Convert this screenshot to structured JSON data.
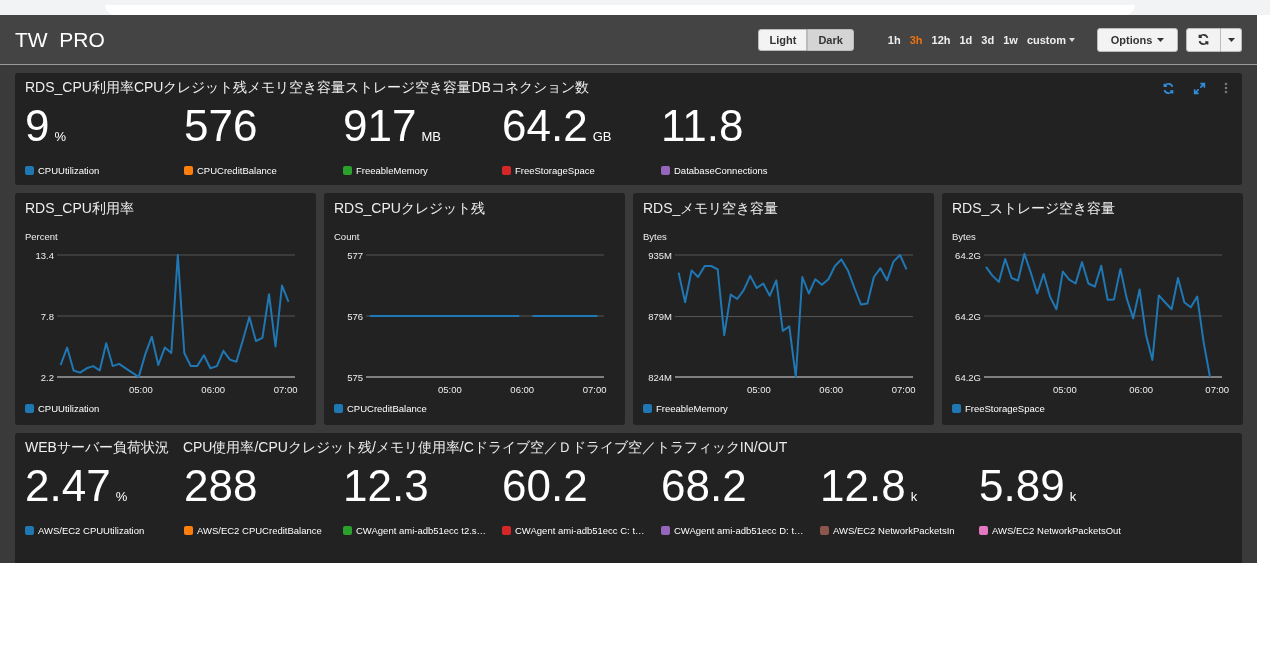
{
  "header": {
    "title": "TW  PRO",
    "theme_buttons": [
      {
        "label": "Light",
        "selected": false
      },
      {
        "label": "Dark",
        "selected": true
      }
    ],
    "time_ranges": [
      {
        "label": "1h",
        "selected": false,
        "kind": "preset"
      },
      {
        "label": "3h",
        "selected": true,
        "kind": "preset"
      },
      {
        "label": "12h",
        "selected": false,
        "kind": "preset"
      },
      {
        "label": "1d",
        "selected": false,
        "kind": "preset"
      },
      {
        "label": "3d",
        "selected": false,
        "kind": "preset"
      },
      {
        "label": "1w",
        "selected": false,
        "kind": "preset"
      },
      {
        "label": "custom",
        "selected": false,
        "kind": "dropdown"
      }
    ],
    "options_button": "Options"
  },
  "rds_summary": {
    "title": "RDS_CPU利用率CPUクレジット残メモリ空き容量ストレージ空き容量DBコネクション数",
    "metrics": [
      {
        "value": "9",
        "unit": "%",
        "label": "CPUUtilization",
        "color": "#1f77b4"
      },
      {
        "value": "576",
        "label": "CPUCreditBalance",
        "color": "#ff7f0e"
      },
      {
        "value": "917",
        "unit": "MB",
        "label": "FreeableMemory",
        "color": "#2ca02c"
      },
      {
        "value": "64.2",
        "unit": "GB",
        "label": "FreeStorageSpace",
        "color": "#d62728"
      },
      {
        "value": "11.8",
        "label": "DatabaseConnections",
        "color": "#9467bd"
      }
    ]
  },
  "charts": [
    {
      "kind": "line",
      "title": "RDS_CPU利用率",
      "chart_data": {
        "type": "line",
        "ylabel": "Percent",
        "x": [
          3.89,
          3.98,
          4.07,
          4.16,
          4.25,
          4.34,
          4.43,
          4.52,
          4.61,
          4.7,
          4.79,
          4.88,
          4.97,
          5.06,
          5.15,
          5.24,
          5.33,
          5.42,
          5.51,
          5.6,
          5.69,
          5.78,
          5.87,
          5.96,
          6.05,
          6.14,
          6.23,
          6.32,
          6.41,
          6.5,
          6.59,
          6.68,
          6.77,
          6.86,
          6.95,
          7.04
        ],
        "xlim": [
          3.84,
          7.13
        ],
        "xticks": [
          {
            "value": 5,
            "label": "05:00"
          },
          {
            "value": 6,
            "label": "06:00"
          },
          {
            "value": 7,
            "label": "07:00"
          }
        ],
        "ylim": [
          2.2,
          13.4
        ],
        "yticks": [
          2.2,
          7.8,
          13.4
        ],
        "series": [
          {
            "name": "CPUUtilization",
            "color": "#1f77b4",
            "values": [
              3.3,
              4.9,
              2.8,
              2.6,
              3.0,
              3.2,
              2.8,
              5.3,
              3.2,
              3.4,
              3.0,
              2.6,
              2.2,
              4.3,
              5.9,
              3.3,
              4.9,
              4.4,
              13.4,
              4.4,
              3.2,
              3.2,
              4.2,
              3.0,
              3.2,
              4.6,
              3.8,
              3.6,
              5.6,
              7.7,
              5.5,
              5.8,
              9.8,
              5.0,
              10.6,
              9.1
            ]
          }
        ]
      }
    },
    {
      "kind": "line",
      "title": "RDS_CPUクレジット残",
      "chart_data": {
        "type": "line",
        "ylabel": "Count",
        "x": [
          3.89,
          3.98,
          4.07,
          4.16,
          4.25,
          4.34,
          4.43,
          4.52,
          4.61,
          4.7,
          4.79,
          4.88,
          4.97,
          5.06,
          5.15,
          5.24,
          5.33,
          5.42,
          5.51,
          5.6,
          5.69,
          5.78,
          5.87,
          5.96,
          6.05,
          6.14,
          6.23,
          6.32,
          6.41,
          6.5,
          6.59,
          6.68,
          6.77,
          6.86,
          6.95,
          7.04
        ],
        "xlim": [
          3.84,
          7.13
        ],
        "xticks": [
          {
            "value": 5,
            "label": "05:00"
          },
          {
            "value": 6,
            "label": "06:00"
          },
          {
            "value": 7,
            "label": "07:00"
          }
        ],
        "ylim": [
          575,
          577
        ],
        "yticks": [
          575,
          576,
          577
        ],
        "series": [
          {
            "name": "CPUCreditBalance",
            "color": "#1f77b4",
            "values": [
              576,
              576,
              576,
              576,
              576,
              576,
              576,
              576,
              576,
              576,
              576,
              576,
              576,
              576,
              576,
              576,
              576,
              576,
              576,
              576,
              576,
              576,
              576,
              576,
              null,
              576,
              576,
              576,
              576,
              576,
              576,
              576,
              576,
              576,
              576,
              576
            ]
          }
        ]
      }
    },
    {
      "kind": "line",
      "title": "RDS_メモリ空き容量",
      "chart_data": {
        "type": "line",
        "ylabel": "Bytes",
        "x": [
          3.89,
          3.98,
          4.07,
          4.16,
          4.25,
          4.34,
          4.43,
          4.52,
          4.61,
          4.7,
          4.79,
          4.88,
          4.97,
          5.06,
          5.15,
          5.24,
          5.33,
          5.42,
          5.51,
          5.6,
          5.69,
          5.78,
          5.87,
          5.96,
          6.05,
          6.14,
          6.23,
          6.32,
          6.41,
          6.5,
          6.59,
          6.68,
          6.77,
          6.86,
          6.95,
          7.04
        ],
        "xlim": [
          3.84,
          7.13
        ],
        "xticks": [
          {
            "value": 5,
            "label": "05:00"
          },
          {
            "value": 6,
            "label": "06:00"
          },
          {
            "value": 7,
            "label": "07:00"
          }
        ],
        "ylim": [
          824,
          935
        ],
        "yticks": [
          {
            "value": 824,
            "label": "824M"
          },
          {
            "value": 879,
            "label": "879M"
          },
          {
            "value": 935,
            "label": "935M"
          }
        ],
        "series": [
          {
            "name": "FreeableMemory",
            "color": "#1f77b4",
            "values": [
              919,
              892,
              921,
              915,
              925,
              925,
              922,
              862,
              899,
              895,
              903,
              916,
              905,
              909,
              898,
              912,
              866,
              870,
              824,
              915,
              900,
              913,
              908,
              913,
              925,
              931,
              921,
              905,
              890,
              891,
              915,
              923,
              912,
              929,
              935,
              922
            ]
          }
        ]
      }
    },
    {
      "kind": "sparkline",
      "title": "RDS_ストレージ空き容量",
      "ylabel": "Bytes",
      "y_tick_labels": [
        "64.2G",
        "64.2G",
        "64.2G"
      ],
      "x_tick_labels": [
        "05:00",
        "06:00",
        "07:00"
      ],
      "legend": {
        "name": "FreeStorageSpace",
        "color": "#1f77b4"
      }
    }
  ],
  "web_summary": {
    "title": "WEBサーバー負荷状況　CPU使用率/CPUクレジット残/メモリ使用率/Cドライブ空／Ｄドライブ空／トラフィックIN/OUT",
    "metrics": [
      {
        "value": "2.47",
        "unit": "%",
        "label": "AWS/EC2 CPUUtilization",
        "color": "#1f77b4"
      },
      {
        "value": "288",
        "label": "AWS/EC2 CPUCreditBalance",
        "color": "#ff7f0e"
      },
      {
        "value": "12.3",
        "label": "CWAgent ami-adb51ecc t2.s…",
        "color": "#2ca02c"
      },
      {
        "value": "60.2",
        "label": "CWAgent ami-adb51ecc C: t…",
        "color": "#d62728"
      },
      {
        "value": "68.2",
        "label": "CWAgent ami-adb51ecc D: t…",
        "color": "#9467bd"
      },
      {
        "value": "12.8",
        "unit": "k",
        "label": "AWS/EC2 NetworkPacketsIn",
        "color": "#8c564b"
      },
      {
        "value": "5.89",
        "unit": "k",
        "label": "AWS/EC2 NetworkPacketsOut",
        "color": "#e377c2"
      }
    ]
  }
}
